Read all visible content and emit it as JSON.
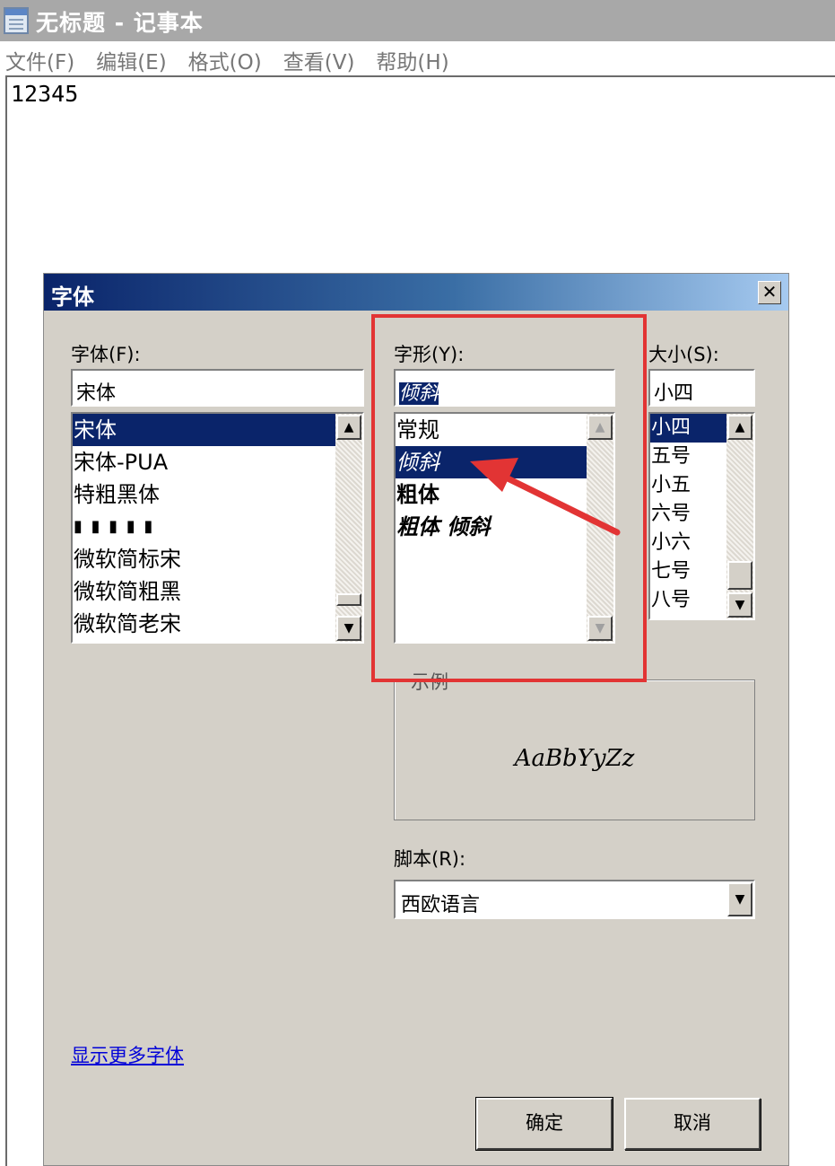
{
  "notepad": {
    "title": "无标题 - 记事本",
    "menu": [
      "文件(F)",
      "编辑(E)",
      "格式(O)",
      "查看(V)",
      "帮助(H)"
    ],
    "content": "12345"
  },
  "dialog": {
    "title": "字体",
    "close_label": "✕",
    "font": {
      "label": "字体(F):",
      "value": "宋体",
      "items": [
        "宋体",
        "宋体-PUA",
        "特粗黑体",
        "▮ ▮ ▮ ▮ ▮",
        "微软简标宋",
        "微软简粗黑",
        "微软简老宋"
      ],
      "selected": "宋体"
    },
    "style": {
      "label": "字形(Y):",
      "value": "倾斜",
      "items": [
        "常规",
        "倾斜",
        "粗体",
        "粗体 倾斜"
      ],
      "selected": "倾斜"
    },
    "size": {
      "label": "大小(S):",
      "value": "小四",
      "items": [
        "小四",
        "五号",
        "小五",
        "六号",
        "小六",
        "七号",
        "八号"
      ],
      "selected": "小四"
    },
    "sample": {
      "legend": "示例",
      "text": "AaBbYyZz"
    },
    "script": {
      "label": "脚本(R):",
      "value": "西欧语言"
    },
    "more_fonts_link": "显示更多字体",
    "ok_button": "确定",
    "cancel_button": "取消"
  },
  "colors": {
    "selection": "#0a246a",
    "dialog_bg": "#d4d0c8",
    "annotation": "#e23434",
    "link": "#0000d8"
  }
}
